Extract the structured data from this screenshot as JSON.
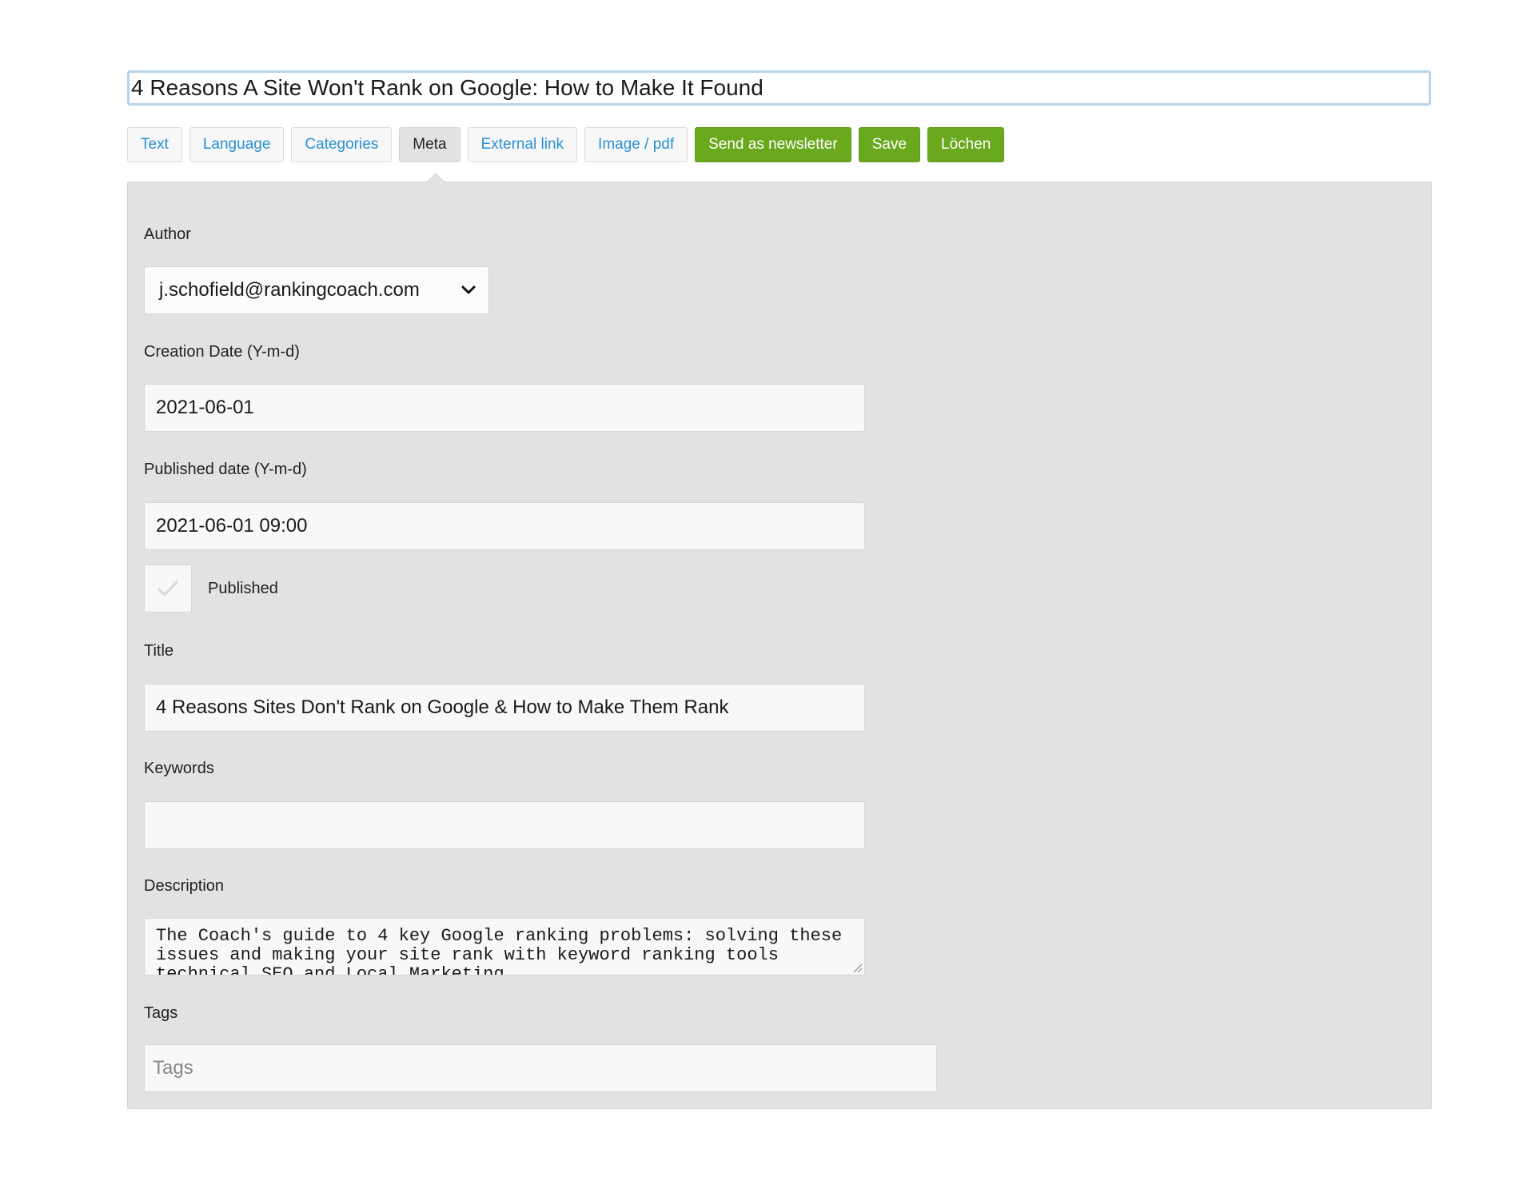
{
  "article": {
    "headline": "4 Reasons A Site Won't Rank on Google: How to Make It Found"
  },
  "tabs": [
    {
      "label": "Text",
      "state": "link"
    },
    {
      "label": "Language",
      "state": "link"
    },
    {
      "label": "Categories",
      "state": "link"
    },
    {
      "label": "Meta",
      "state": "active"
    },
    {
      "label": "External link",
      "state": "link"
    },
    {
      "label": "Image / pdf",
      "state": "link"
    }
  ],
  "actions": {
    "newsletter_label": "Send as newsletter",
    "save_label": "Save",
    "delete_label": "Löchen"
  },
  "meta": {
    "author": {
      "label": "Author",
      "value": "j.schofield@rankingcoach.com",
      "icon": "chevron-down-icon"
    },
    "creation_date": {
      "label": "Creation Date (Y-m-d)",
      "value": "2021-06-01"
    },
    "published_date": {
      "label": "Published date (Y-m-d)",
      "value": "2021-06-01 09:00"
    },
    "published": {
      "label": "Published",
      "checked": true,
      "icon": "checkmark-icon"
    },
    "title": {
      "label": "Title",
      "value": "4 Reasons Sites Don't Rank on Google & How to Make Them Rank"
    },
    "keywords": {
      "label": "Keywords",
      "value": ""
    },
    "description": {
      "label": "Description",
      "value": "The Coach's guide to 4 key Google ranking problems: solving these issues and making your site rank with keyword ranking tools technical SEO and Local Marketing"
    },
    "tags": {
      "label": "Tags",
      "placeholder": "Tags",
      "value": ""
    }
  },
  "colors": {
    "link_blue": "#2a8fd6",
    "action_green": "#6aa81e",
    "panel_gray": "#e3e2e2",
    "headline_border": "#b8d4ec"
  }
}
